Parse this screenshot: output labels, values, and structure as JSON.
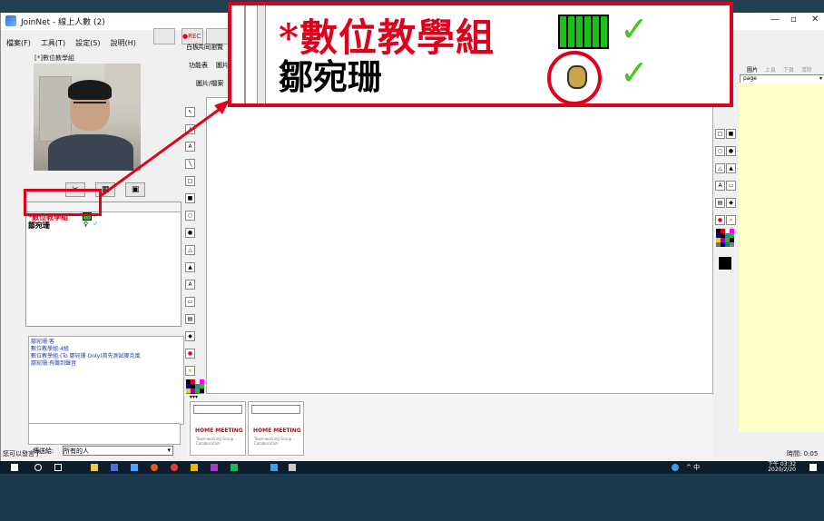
{
  "window": {
    "title": "JoinNet - 線上人數 (2)",
    "minimize": "—",
    "maximize": "▫",
    "close": "✕"
  },
  "menu": [
    "檔案(F)",
    "工具(T)",
    "設定(S)",
    "說明(H)"
  ],
  "toolbar": {
    "rec": "●REC"
  },
  "tabs": [
    "白板",
    "共同瀏覽"
  ],
  "tab_buttons": [
    "功能表",
    "圖片"
  ],
  "sub_toolbar": "圖片/檔案",
  "video": {
    "title": "[*]數位教學組"
  },
  "users": [
    {
      "name": "*數位教學組",
      "color": "#e0001b"
    },
    {
      "name": "鄒宛珊",
      "color": "#000000"
    }
  ],
  "chat_lines": [
    {
      "text": "鄒宛珊:客"
    },
    {
      "text": "數位教學組:4組"
    },
    {
      "text": "數位教學組:(To 鄒宛珊 Only)首先測試麥克風"
    },
    {
      "text": "鄒宛珊:有聽到聲音"
    }
  ],
  "send_to_label": "傳送給:",
  "send_to_value": "所有的人",
  "status_left": "您可以發言了",
  "status_right": "時間: 0:05",
  "right_panel": {
    "page_select": "page",
    "buttons": [
      "圖片",
      "上頁",
      "下頁",
      "清除"
    ]
  },
  "thumbs": [
    {
      "logo": "HOME MEETING",
      "tagline": "Team-working Group Collaboration"
    },
    {
      "logo": "HOME MEETING",
      "tagline": "Team-working Group Collaboration"
    }
  ],
  "thumb_header": "▾▾▾",
  "zoom": {
    "user1": "*數位教學組",
    "user2": "鄒宛珊"
  },
  "clock": {
    "time": "下午 03:32",
    "date": "2020/2/20"
  },
  "taskbar_tray": "^ 中"
}
